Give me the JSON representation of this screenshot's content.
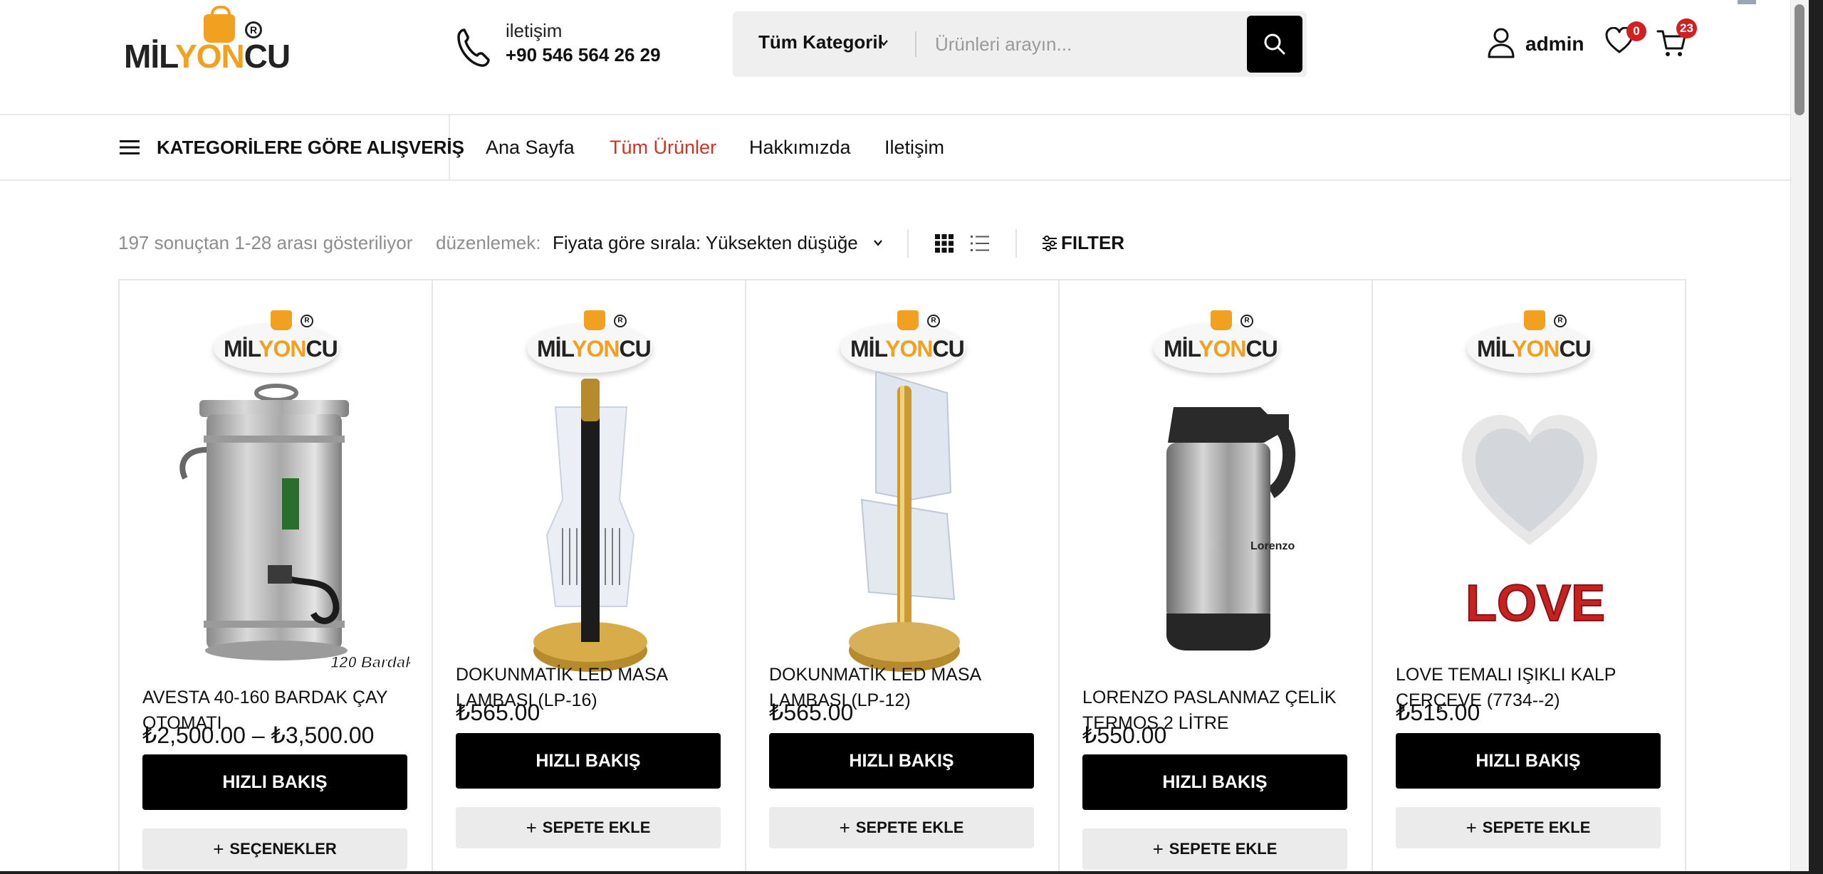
{
  "header": {
    "logo_text_dark": "MİL",
    "logo_text_accent": "YON",
    "logo_text_end": "CU",
    "logo_reg": "R",
    "contact_label": "iletişim",
    "contact_phone": "+90 546 564 26 29",
    "search": {
      "category": "Tüm Kategoril",
      "placeholder": "Ürünleri arayın..."
    },
    "user_name": "admin",
    "wishlist_count": "0",
    "cart_count": "23"
  },
  "nav": {
    "category_menu_label": "KATEGORİLERE GÖRE ALIŞVERİŞ",
    "links": [
      {
        "label": "Ana Sayfa",
        "active": false
      },
      {
        "label": "Tüm Ürünler",
        "active": true
      },
      {
        "label": "Hakkımızda",
        "active": false
      },
      {
        "label": "Iletişim",
        "active": false
      }
    ]
  },
  "toolbar": {
    "result_count": "197 sonuçtan 1-28 arası gösteriliyor",
    "sort_label": "düzenlemek:",
    "sort_value": "Fiyata göre sırala: Yüksekten düşüğe",
    "filter_label": "FILTER"
  },
  "products": [
    {
      "title": "AVESTA 40-160 BARDAK ÇAY OTOMATI",
      "price": "₺2,500.00 – ₺3,500.00",
      "quick_view": "HIZLI BAKIŞ",
      "secondary": "SEÇENEKLER",
      "image_label": "120 Bardak",
      "image_icon": "tea-urn"
    },
    {
      "title": "DOKUNMATİK LED MASA LAMBASI (LP-16)",
      "price": "₺565.00",
      "quick_view": "HIZLI BAKIŞ",
      "secondary": "SEPETE EKLE",
      "image_icon": "led-lamp-dark"
    },
    {
      "title": "DOKUNMATİK LED MASA LAMBASI (LP-12)",
      "price": "₺565.00",
      "quick_view": "HIZLI BAKIŞ",
      "secondary": "SEPETE EKLE",
      "image_icon": "led-lamp-gold"
    },
    {
      "title": "LORENZO PASLANMAZ ÇELİK TERMOS 2 LİTRE",
      "price": "₺550.00",
      "quick_view": "HIZLI BAKIŞ",
      "secondary": "SEPETE EKLE",
      "image_label": "Lorenzo",
      "image_icon": "thermos"
    },
    {
      "title": "LOVE TEMALI IŞIKLI KALP ÇERÇEVE (7734--2)",
      "price": "₺515.00",
      "quick_view": "HIZLI BAKIŞ",
      "secondary": "SEPETE EKLE",
      "image_label": "LOVE",
      "image_icon": "heart-frame"
    }
  ],
  "colors": {
    "accent_red": "#d6301e",
    "logo_orange": "#f2a01f",
    "button_black": "#000000",
    "button_grey": "#ebebeb",
    "badge_red": "#d12020"
  }
}
